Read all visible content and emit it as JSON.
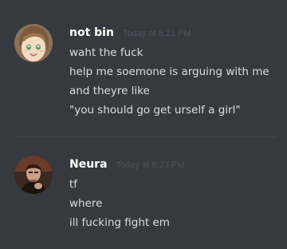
{
  "messages": [
    {
      "username": "not bin",
      "timestamp": "Today at 6:21 PM",
      "avatar_icon": "anime-girl-avatar",
      "lines": [
        "waht the fuck",
        "help me soemone is arguing with me",
        "and theyre like",
        "\"you should go get urself a girl\""
      ]
    },
    {
      "username": "Neura",
      "timestamp": "Today at 6:23 PM",
      "avatar_icon": "person-photo-avatar",
      "lines": [
        "tf",
        "where",
        "ill fucking fight em"
      ]
    }
  ],
  "colors": {
    "background": "#36393f",
    "username": "#ffffff",
    "message_text": "#dcddde",
    "timestamp": "#4f545c"
  }
}
